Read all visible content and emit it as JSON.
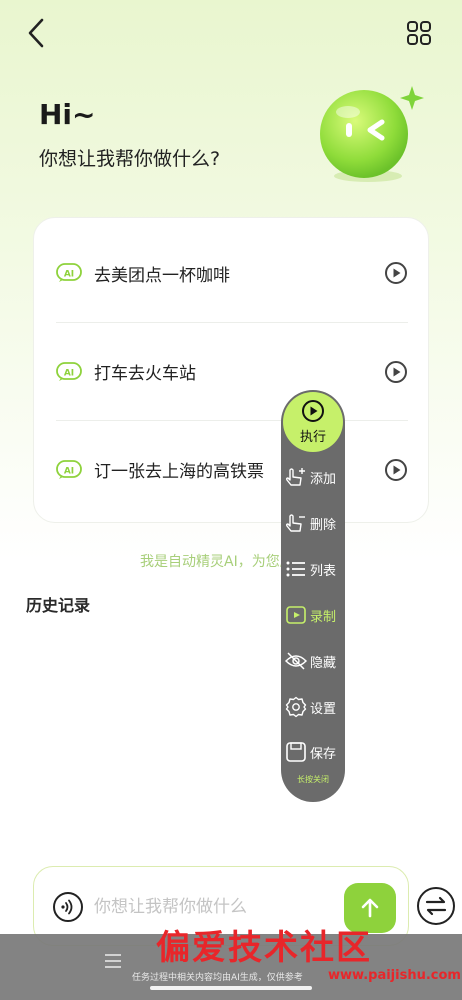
{
  "header": {
    "greeting": "Hi~",
    "subtitle": "你想让我帮你做什么?"
  },
  "suggestions": [
    {
      "label": "去美团点一杯咖啡",
      "badge": "AI"
    },
    {
      "label": "打车去火车站",
      "badge": "AI"
    },
    {
      "label": "订一张去上海的高铁票",
      "badge": "AI"
    }
  ],
  "intro_text": "我是自动精灵AI，为您服务",
  "history_title": "历史记录",
  "floating_menu": {
    "execute": "执行",
    "items": [
      {
        "label": "添加",
        "icon": "hand-add-icon"
      },
      {
        "label": "删除",
        "icon": "hand-delete-icon"
      },
      {
        "label": "列表",
        "icon": "list-icon"
      },
      {
        "label": "录制",
        "icon": "record-icon"
      },
      {
        "label": "隐藏",
        "icon": "eye-hide-icon"
      },
      {
        "label": "设置",
        "icon": "gear-icon"
      },
      {
        "label": "保存",
        "icon": "save-icon"
      }
    ],
    "close_hint": "长按关闭"
  },
  "input": {
    "placeholder": "你想让我帮你做什么",
    "value": ""
  },
  "bottom": {
    "disclaimer": "任务过程中相关内容均由AI生成，仅供参考"
  },
  "watermark": {
    "text": "偏爱技术社区",
    "url": "www.paijishu.com"
  },
  "colors": {
    "accent": "#8ed23c",
    "accent_light": "#c6f06a",
    "fab_bg": "#6b6b6b",
    "watermark": "#e8262a"
  }
}
